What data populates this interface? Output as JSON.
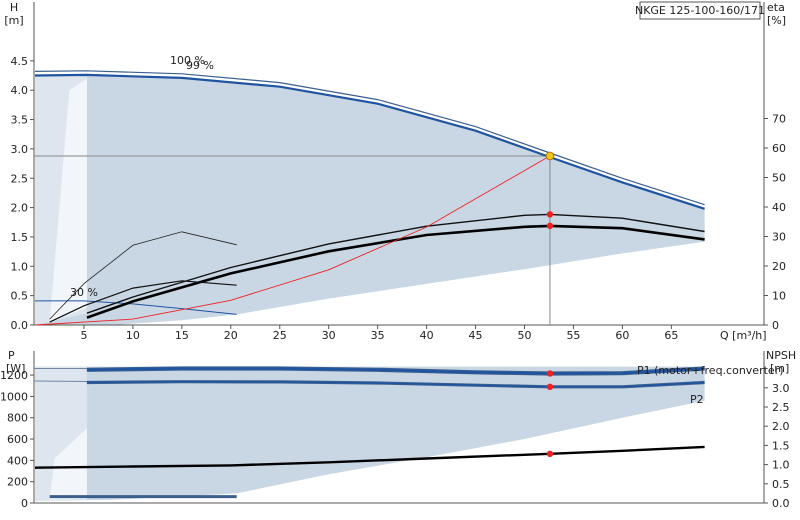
{
  "title": "NKGE 125-100-160/171",
  "colors": {
    "envelope": "#c9d6e3",
    "blue": "#1f55a0",
    "black": "#000000",
    "red": "#ee2222",
    "grey_line": "#888888"
  },
  "chart_data": [
    {
      "type": "line",
      "title": "NKGE 125-100-160/171",
      "xlabel": "Q [m³/h]",
      "ylabel_left": "H\n[m]",
      "ylabel_right": "eta\n[%]",
      "xlim": [
        0,
        72
      ],
      "ylim": [
        0,
        5.1
      ],
      "ylim_right": [
        0,
        85
      ],
      "x_ticks": [
        "5",
        "10",
        "15",
        "20",
        "25",
        "30",
        "35",
        "40",
        "45",
        "50",
        "55",
        "60",
        "65"
      ],
      "y_ticks": [
        "0.0",
        "0.5",
        "1.0",
        "1.5",
        "2.0",
        "2.5",
        "3.0",
        "3.5",
        "4.0",
        "4.5"
      ],
      "y_ticks_right": [
        "0",
        "10",
        "20",
        "30",
        "40",
        "50",
        "60",
        "70"
      ],
      "annotations": [
        "100 %",
        "99 %",
        "30 %"
      ],
      "duty_point": {
        "Q": 52.6,
        "H": 2.88,
        "eta_pump": 37.5,
        "eta_total": 33.6
      },
      "series": [
        {
          "role": "head-100pct",
          "x": [
            0,
            5.3,
            15,
            25,
            35,
            45,
            52.6,
            60,
            68.4
          ],
          "y": [
            4.32,
            4.33,
            4.28,
            4.13,
            3.84,
            3.38,
            2.93,
            2.5,
            2.05
          ]
        },
        {
          "role": "head-99pct",
          "x": [
            0,
            5.3,
            15,
            25,
            35,
            45,
            52.6,
            60,
            68.4
          ],
          "y": [
            4.25,
            4.26,
            4.21,
            4.06,
            3.77,
            3.31,
            2.86,
            2.43,
            1.98
          ]
        },
        {
          "role": "head-30pct",
          "x": [
            0,
            5,
            10,
            15,
            20.6
          ],
          "y": [
            0.41,
            0.41,
            0.36,
            0.28,
            0.18
          ]
        },
        {
          "role": "efficiency-pump",
          "x": [
            5.3,
            10,
            20,
            30,
            40,
            50,
            52.6,
            60,
            68.4
          ],
          "y_eta": [
            4,
            9.5,
            19.5,
            27.5,
            33.5,
            37.2,
            37.5,
            36.2,
            31.7
          ]
        },
        {
          "role": "efficiency-total",
          "x": [
            5.3,
            10,
            20,
            30,
            40,
            50,
            52.6,
            60,
            68.4
          ],
          "y_eta": [
            2.5,
            8,
            17.5,
            25,
            30.5,
            33.3,
            33.6,
            32.8,
            29
          ]
        },
        {
          "role": "efficiency-pump-30pct",
          "x": [
            1.5,
            5,
            10,
            15,
            20.6
          ],
          "y_eta": [
            2,
            14,
            27,
            31.6,
            27.2
          ]
        },
        {
          "role": "efficiency-total-30pct",
          "x": [
            1.5,
            5,
            10,
            15,
            20.6
          ],
          "y_eta": [
            1,
            6.5,
            12.5,
            15,
            13.5
          ]
        },
        {
          "role": "system-curve",
          "x": [
            0,
            10,
            20,
            30,
            40,
            52.6
          ],
          "y": [
            0.0,
            0.1,
            0.42,
            0.94,
            1.67,
            2.88
          ]
        }
      ]
    },
    {
      "type": "line",
      "ylabel_left": "P\n[W]",
      "ylabel_right": "NPSH\n[m]",
      "xlim": [
        0,
        72
      ],
      "ylim": [
        0,
        1400
      ],
      "ylim_right": [
        0,
        3.5
      ],
      "y_ticks": [
        "0",
        "200",
        "400",
        "600",
        "800",
        "1000",
        "1200"
      ],
      "y_ticks_right": [
        "0.0",
        "0.5",
        "1.0",
        "1.5",
        "2.0",
        "2.5",
        "3.0"
      ],
      "legend": [
        "P1 (motor+freq.converter)",
        "P2"
      ],
      "series": [
        {
          "name": "P1 (motor+freq.converter)",
          "x": [
            5.3,
            15,
            25,
            35,
            45,
            52.6,
            60,
            68.4
          ],
          "y": [
            1250,
            1262,
            1262,
            1250,
            1226,
            1215,
            1218,
            1262
          ]
        },
        {
          "name": "P2",
          "x": [
            5.3,
            15,
            25,
            35,
            45,
            52.6,
            60,
            68.4
          ],
          "y": [
            1130,
            1138,
            1136,
            1126,
            1105,
            1090,
            1090,
            1130
          ]
        },
        {
          "role": "npsh",
          "x": [
            0,
            10,
            20,
            30,
            40,
            52.6,
            60,
            68.4
          ],
          "y_npsh": [
            0.92,
            0.95,
            0.98,
            1.06,
            1.16,
            1.28,
            1.36,
            1.46
          ]
        },
        {
          "role": "power-30pct",
          "x": [
            1.5,
            20.6
          ],
          "y": [
            60,
            60
          ]
        }
      ]
    }
  ]
}
